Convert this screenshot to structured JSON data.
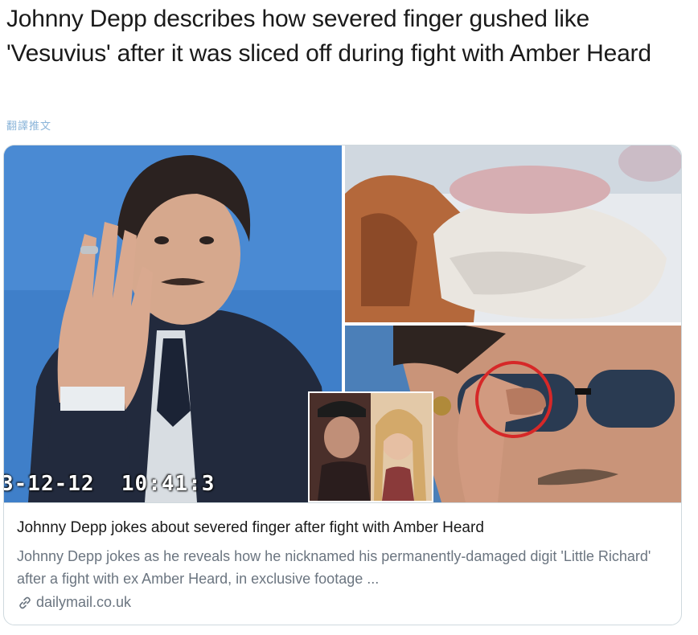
{
  "tweet": {
    "text": "Johnny Depp describes how severed finger gushed like 'Vesuvius' after it was sliced off during fight with Amber Heard",
    "translate_label": "翻譯推文"
  },
  "card": {
    "media": {
      "left_image": "johnny-depp-courtroom-photo",
      "top_right_image": "blurred-finger-photo",
      "bottom_right_image": "depp-sunglasses-finger-photo",
      "inset_image": "depp-and-heard-photo",
      "timestamp_overlay": "3-12-12  10:41:3"
    },
    "title": "Johnny Depp jokes about severed finger after fight with Amber Heard",
    "description": "Johnny Depp jokes as he reveals how he nicknamed his permanently-damaged digit 'Little Richard' after a fight with ex Amber Heard, in exclusive footage ...",
    "domain": "dailymail.co.uk",
    "domain_icon": "link-icon"
  },
  "colors": {
    "card_border": "#cfd9de",
    "secondary_text": "#6b7580",
    "translate_link": "#8ab4d9",
    "highlight_circle": "#d62828"
  }
}
